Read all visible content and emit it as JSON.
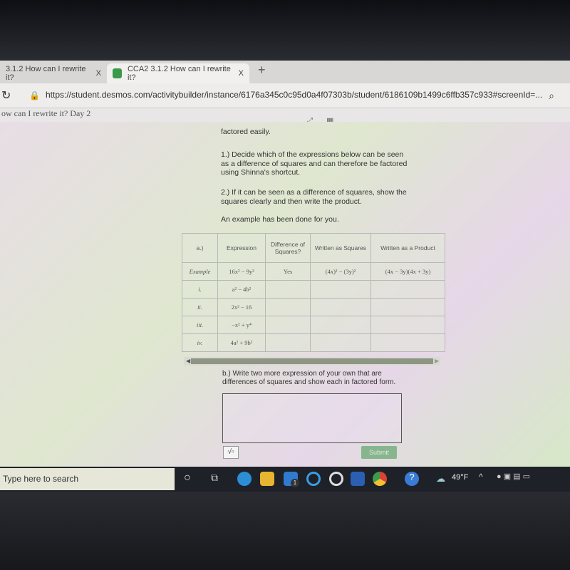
{
  "browser": {
    "tabs": [
      {
        "label": "3.1.2 How can I rewrite it?",
        "close": "X"
      },
      {
        "label": "CCA2 3.1.2 How can I rewrite it?",
        "close": "X"
      }
    ],
    "new_tab": "+",
    "url": "https://student.desmos.com/activitybuilder/instance/6176a345c0c95d0a4f07303b/student/6186109b1499c6ffb357c933#screenId=...",
    "page_title": "ow can I rewrite it? Day 2"
  },
  "activity": {
    "cut_text": "factored easily.",
    "instruction1": "1.) Decide which of the expressions below can be seen as a difference of squares and can therefore be factored using Shinna's shortcut.",
    "instruction2": "2.) If it can be seen as a difference of squares, show the squares clearly and then write the product.",
    "example_note": "An example has been done for you.",
    "table": {
      "headers": [
        "a.)",
        "Expression",
        "Difference of Squares?",
        "Written as Squares",
        "Written as a Product"
      ],
      "rows": [
        [
          "Example",
          "16x² − 9y²",
          "Yes",
          "(4x)² − (3y)²",
          "(4x − 3y)(4x + 3y)"
        ],
        [
          "i.",
          "a² − 4b²",
          "",
          "",
          ""
        ],
        [
          "ii.",
          "2x² − 16",
          "",
          "",
          ""
        ],
        [
          "iii.",
          "−x² + y⁴",
          "",
          "",
          ""
        ],
        [
          "iv.",
          "4a² + 9b²",
          "",
          "",
          ""
        ]
      ]
    },
    "part_b": "b.) Write two more expression of your own that are differences of squares and show each in factored form.",
    "answer_value": "",
    "sqrt_label": "√▫",
    "submit_label": "Submit"
  },
  "taskbar": {
    "search_placeholder": "Type here to search",
    "mail_badge": "1",
    "weather": "49°F"
  }
}
